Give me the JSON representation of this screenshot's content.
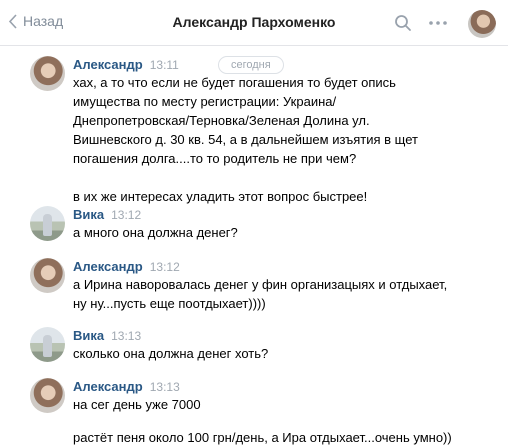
{
  "header": {
    "back_label": "Назад",
    "title": "Александр Пархоменко"
  },
  "date_divider": "сегодня",
  "messages": [
    {
      "author": "Александр",
      "time": "13:11",
      "lines": [
        "хах, а то что если не будет погашения то будет опись",
        "имущества по месту регистрации: Украина/",
        "Днепропетровская/Терновка/Зеленая Долина ул.",
        "Вишневского д. 30 кв. 54, а в дальнейшем изъятия в щет",
        "погашения долга....то то родитель не при чем?",
        "",
        "в их же интересах уладить этот вопрос быстрее!"
      ]
    },
    {
      "author": "Вика",
      "time": "13:12",
      "lines": [
        "а много она должна денег?"
      ]
    },
    {
      "author": "Александр",
      "time": "13:12",
      "lines": [
        "а Ирина наворовалась денег у фин организацыях и отдыхает,",
        "ну ну...пусть еще поотдыхает))))"
      ]
    },
    {
      "author": "Вика",
      "time": "13:13",
      "lines": [
        "сколько она должна денег хоть?"
      ]
    },
    {
      "author": "Александр",
      "time": "13:13",
      "lines": [
        "на сег день уже 7000",
        "",
        "растёт пеня около 100 грн/день, а Ира отдыхает...очень умно))"
      ]
    }
  ]
}
